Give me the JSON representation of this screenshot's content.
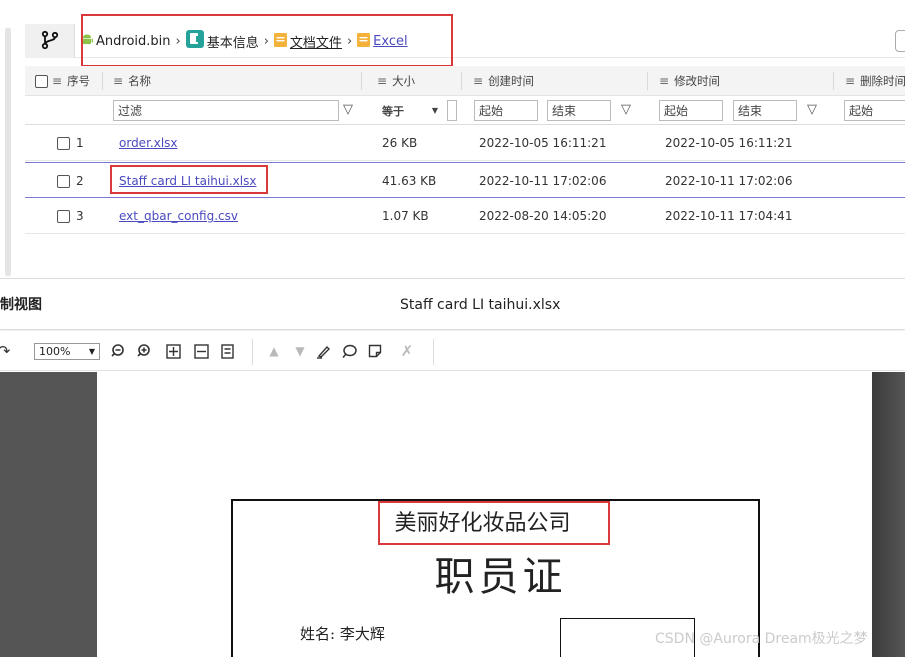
{
  "breadcrumb": {
    "items": [
      {
        "label": "Android.bin",
        "icon": "android-icon"
      },
      {
        "label": "基本信息",
        "icon": "info-badge-icon"
      },
      {
        "label": "文档文件",
        "icon": "folder-icon"
      },
      {
        "label": "Excel",
        "icon": "folder-icon"
      }
    ],
    "separator": "›"
  },
  "table": {
    "columns": {
      "index": "序号",
      "name": "名称",
      "size": "大小",
      "created": "创建时间",
      "modified": "修改时间",
      "deleted": "删除时间"
    },
    "filter": {
      "name_placeholder": "过滤",
      "size_op": "等于",
      "created_start": "起始",
      "created_end": "结束",
      "modified_start": "起始",
      "modified_end": "结束",
      "deleted_start": "起始"
    },
    "rows": [
      {
        "index": "1",
        "name": "order.xlsx",
        "size": "26 KB",
        "created": "2022-10-05 16:11:21",
        "modified": "2022-10-05 16:11:21"
      },
      {
        "index": "2",
        "name": "Staff card LI taihui.xlsx",
        "size": "41.63 KB",
        "created": "2022-10-11 17:02:06",
        "modified": "2022-10-11 17:02:06"
      },
      {
        "index": "3",
        "name": "ext_qbar_config.csv",
        "size": "1.07 KB",
        "created": "2022-08-20 14:05:20",
        "modified": "2022-10-11 17:04:41"
      }
    ]
  },
  "preview": {
    "left_label": "制视图",
    "file_title": "Staff card LI taihui.xlsx",
    "zoom_value": "100%"
  },
  "document": {
    "company": "美丽好化妆品公司",
    "title": "职员证",
    "name_line": "姓名: 李大辉"
  },
  "watermark": "CSDN @Aurora Dream极光之梦",
  "colors": {
    "highlight": "#d9393a",
    "link": "#4a4ac0",
    "viewer_bg": "#555555"
  }
}
